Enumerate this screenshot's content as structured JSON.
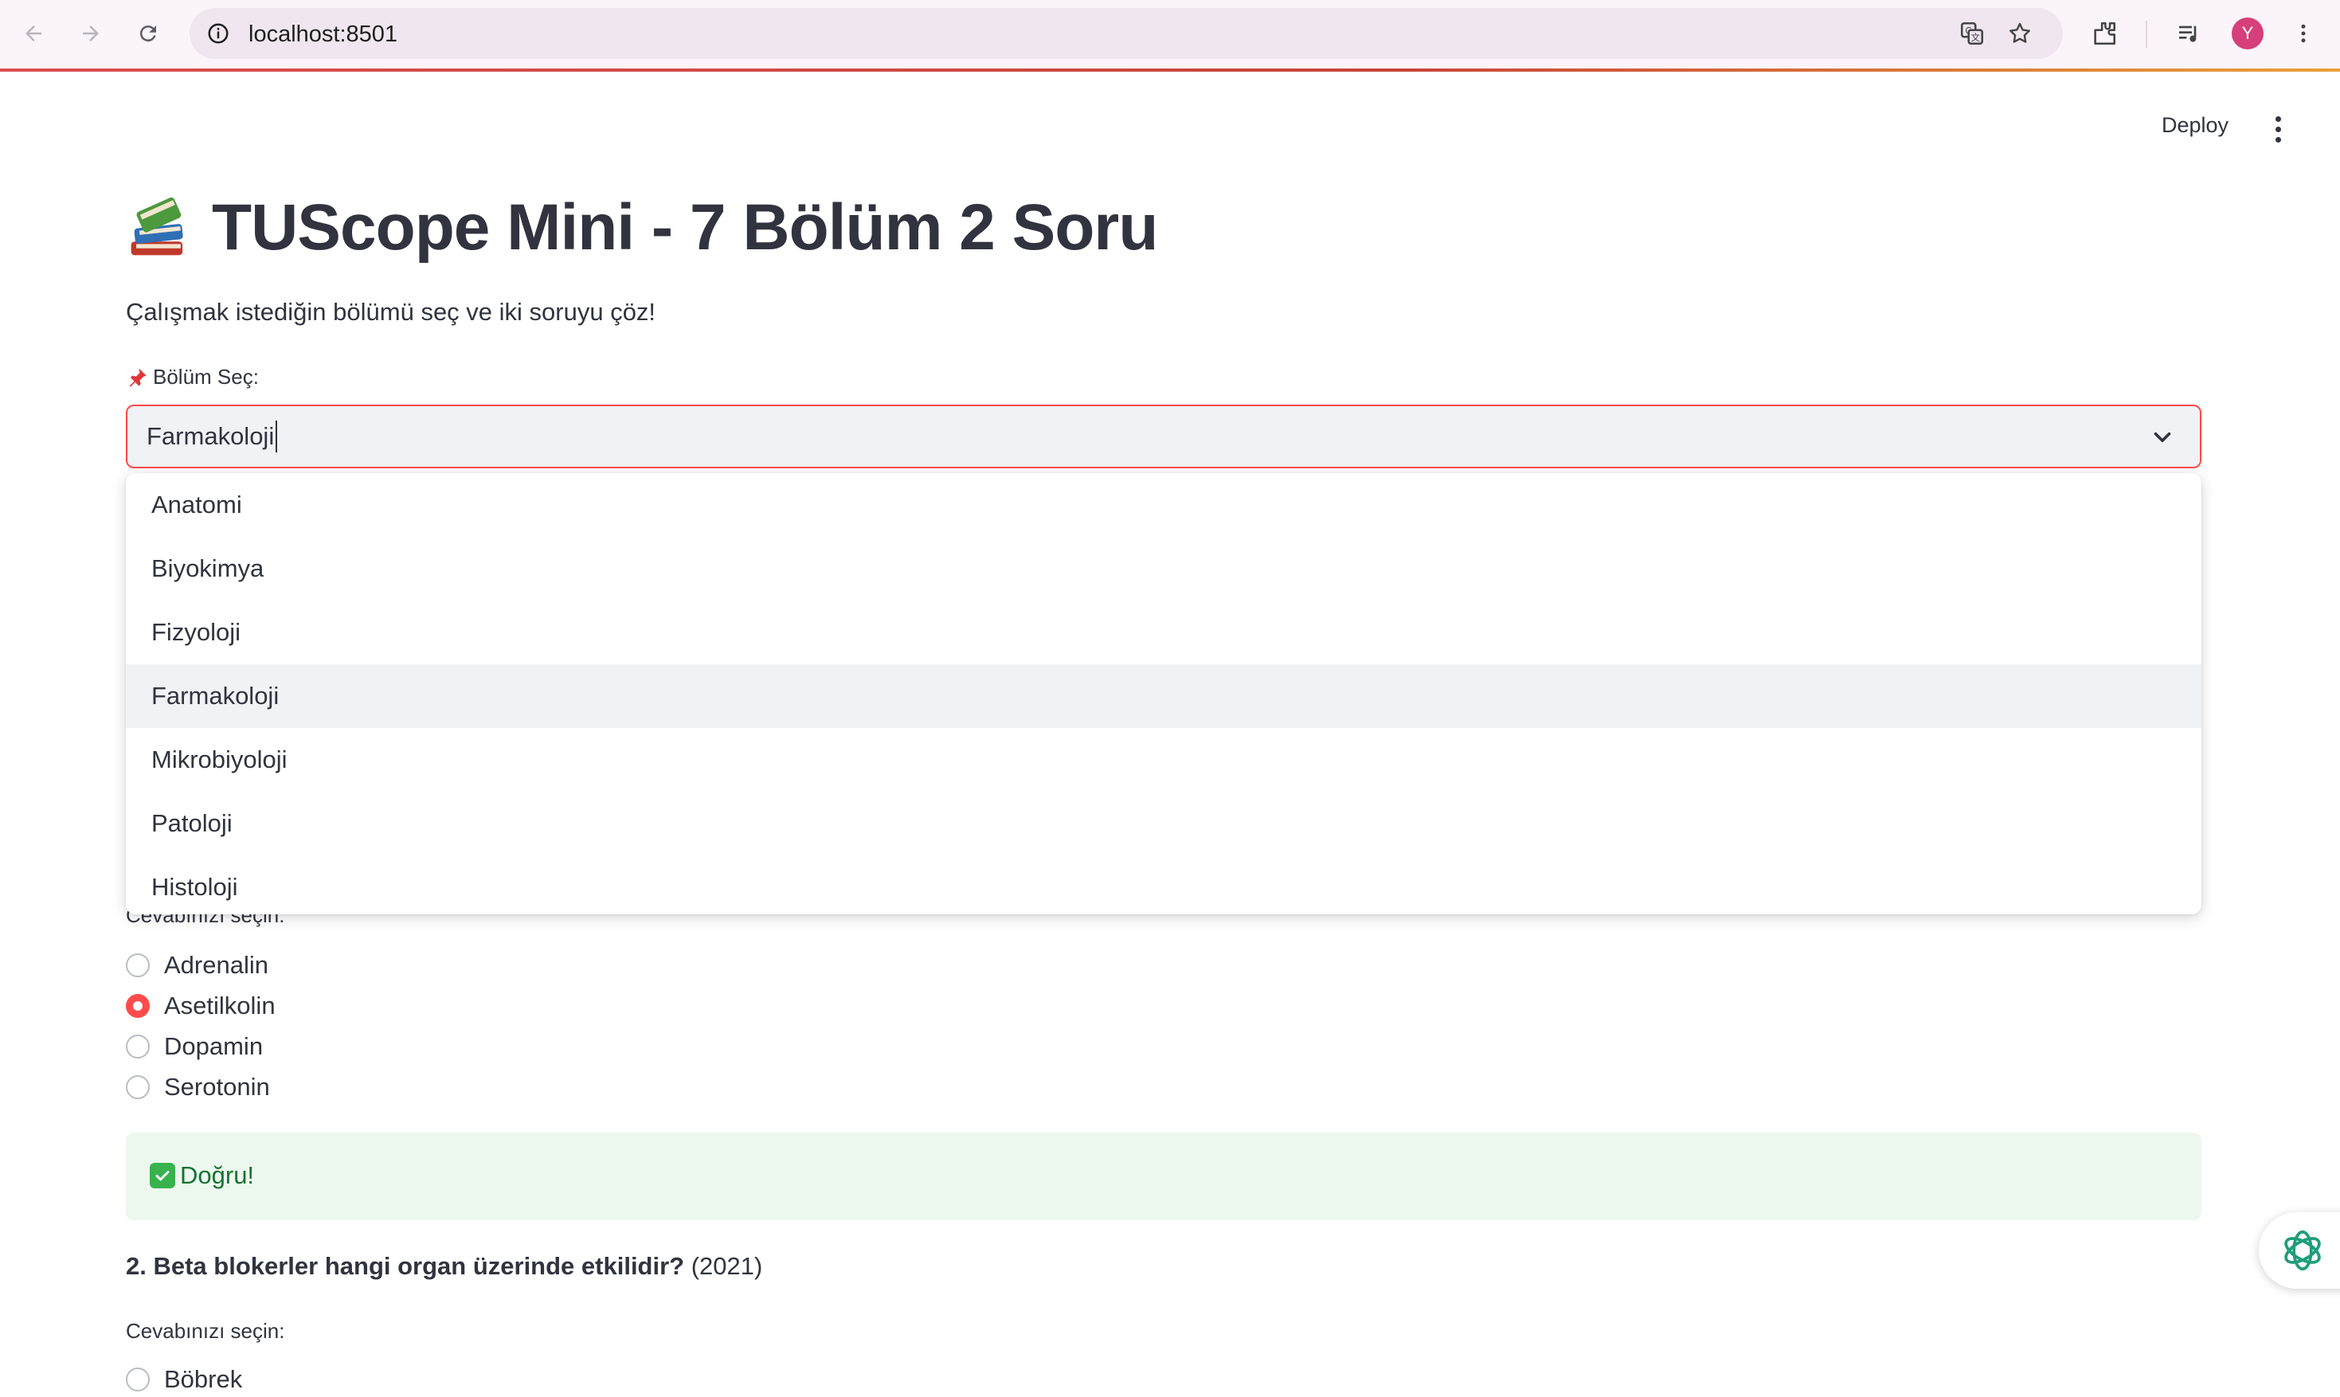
{
  "browser": {
    "url": "localhost:8501",
    "profile_initial": "Y"
  },
  "header": {
    "deploy_label": "Deploy"
  },
  "main": {
    "title": "TUScope Mini - 7 Bölüm 2 Soru",
    "intro": "Çalışmak istediğin bölümü seç ve iki soruyu çöz!",
    "select": {
      "label": "Bölüm Seç:",
      "value": "Farmakoloji",
      "options": [
        "Anatomi",
        "Biyokimya",
        "Fizyoloji",
        "Farmakoloji",
        "Mikrobiyoloji",
        "Patoloji",
        "Histoloji"
      ],
      "highlighted": "Farmakoloji"
    },
    "question1": {
      "answer_label": "Cevabınızı seçin:",
      "options": [
        "Adrenalin",
        "Asetilkolin",
        "Dopamin",
        "Serotonin"
      ],
      "selected": "Asetilkolin",
      "feedback": "Doğru!"
    },
    "question2": {
      "text": "2. Beta blokerler hangi organ üzerinde etkilidir?",
      "year": "(2021)",
      "answer_label": "Cevabınızı seçin:",
      "options": [
        "Böbrek"
      ]
    }
  },
  "colors": {
    "accent": "#ff4b4b",
    "success_bg": "#ecf8ee",
    "success_text": "#177233"
  }
}
